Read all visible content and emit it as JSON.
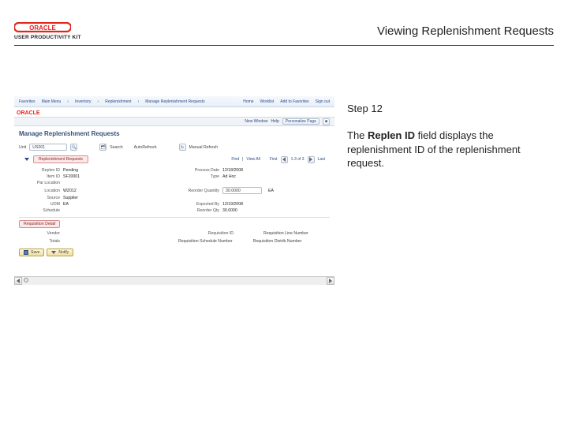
{
  "header": {
    "logo_sub": "USER PRODUCTIVITY KIT",
    "page_title": "Viewing Replenishment Requests"
  },
  "instruction": {
    "step_label": "Step 12",
    "text_1": "The ",
    "text_bold": "Replen ID",
    "text_2": " field displays the replenishment ID of the replenishment request."
  },
  "app": {
    "topnav": {
      "items": [
        "Favorites",
        "Main Menu",
        "Inventory",
        "Replenishment",
        "Manage Replenishment Requests"
      ],
      "links": [
        "Home",
        "Worklist",
        "Add to Favorites",
        "Sign out"
      ]
    },
    "toolbar": {
      "link": "New Window",
      "help": "Help",
      "btn": "Personalize Page"
    },
    "heading": "Manage Replenishment Requests",
    "find_row": {
      "unit_label": "Unit",
      "unit_value": "US001",
      "search_btn": "Search",
      "autorefresh": "AutoRefresh",
      "manual_refresh": "Manual Refresh"
    },
    "section_tab": "Replenishment Requests",
    "nav": {
      "find": "Find",
      "view_all": "View All",
      "first": "First",
      "page": "1-3 of 3",
      "last": "Last"
    },
    "fields": {
      "replen_id_label": "Replen ID",
      "replen_id_value": "Pending",
      "process_date_label": "Process Date",
      "process_date_value": "12/18/2008",
      "item_id_label": "Item ID",
      "item_id_value": "SF20001",
      "type_label": "Type",
      "type_value": "Ad Hoc",
      "par_loc_label": "Par Location",
      "locator_label": "Location",
      "locator_value": "WZ012",
      "reorder_qty_label": "Reorder Quantity",
      "reorder_qty_value": "30.0000",
      "source_label": "Source",
      "source_value": "Supplier",
      "uom_label": "UOM",
      "uom_value": "EA",
      "expected_by_label": "Expected By",
      "expected_by_value": "12/19/2008",
      "sched_label": "Schedule",
      "reorder_qty2_label": "Reorder Qty",
      "reorder_qty2_value": "30.0000"
    },
    "req_detail": "Requisition Detail",
    "req_row": {
      "vendor_label": "Vendor",
      "req_id_label": "Requisition ID",
      "req_line_label": "Requisition Line Number"
    },
    "totals": {
      "label": "Totals",
      "rsl_label": "Requisition Schedule Number",
      "rdl_label": "Requisition Distrib Number"
    },
    "buttons": {
      "save": "Save",
      "notify": "Notify"
    }
  }
}
